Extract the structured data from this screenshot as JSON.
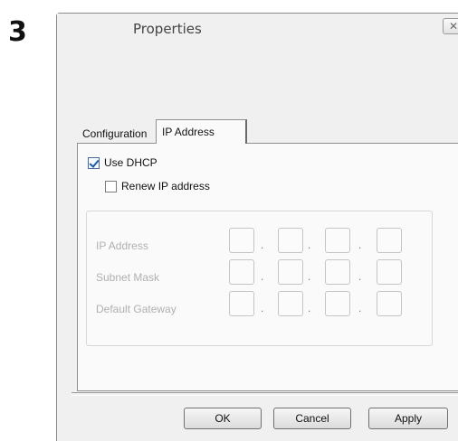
{
  "step_number": "3",
  "window": {
    "title": "Properties",
    "close_glyph": "✕"
  },
  "tabs": [
    {
      "label": "Configuration",
      "active": false
    },
    {
      "label": "IP Address",
      "active": true
    }
  ],
  "use_dhcp": {
    "label": "Use DHCP",
    "checked": true
  },
  "renew_ip": {
    "label": "Renew IP address",
    "checked": false
  },
  "fields": {
    "ip_address": {
      "label": "IP Address",
      "octets": [
        "",
        "",
        "",
        ""
      ]
    },
    "subnet_mask": {
      "label": "Subnet Mask",
      "octets": [
        "",
        "",
        "",
        ""
      ]
    },
    "default_gateway": {
      "label": "Default Gateway",
      "octets": [
        "",
        "",
        "",
        ""
      ]
    }
  },
  "octet_separator": ".",
  "buttons": {
    "ok": "OK",
    "cancel": "Cancel",
    "apply": "Apply"
  },
  "icons": {
    "close": "close-icon",
    "checkbox_checked": "checkmark-icon"
  }
}
